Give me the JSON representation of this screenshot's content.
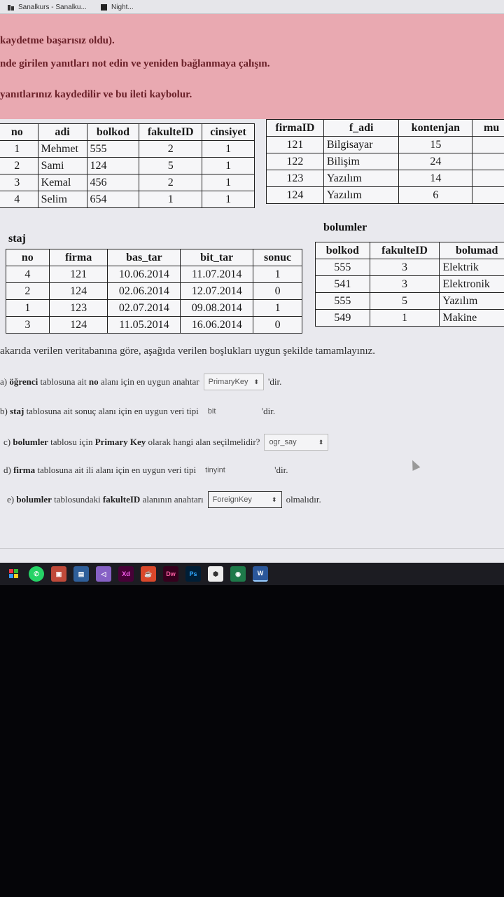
{
  "browser": {
    "tabs": [
      "Sanalkurs - Sanalku...",
      "Night..."
    ]
  },
  "alert": {
    "lines": [
      "kaydetme başarısız oldu).",
      "nde girilen yanıtları not edin ve yeniden bağlanmaya çalışın.",
      "yanıtlarınız kaydedilir ve bu ileti kaybolur."
    ]
  },
  "ogrenci": {
    "headers": [
      "no",
      "adi",
      "bolkod",
      "fakulteID",
      "cinsiyet"
    ],
    "rows": [
      [
        "1",
        "Mehmet",
        "555",
        "2",
        "1"
      ],
      [
        "2",
        "Sami",
        "124",
        "5",
        "1"
      ],
      [
        "3",
        "Kemal",
        "456",
        "2",
        "1"
      ],
      [
        "4",
        "Selim",
        "654",
        "1",
        "1"
      ]
    ]
  },
  "firma": {
    "headers": [
      "firmaID",
      "f_adi",
      "kontenjan",
      "mu"
    ],
    "rows": [
      [
        "121",
        "Bilgisayar",
        "15",
        ""
      ],
      [
        "122",
        "Bilişim",
        "24",
        ""
      ],
      [
        "123",
        "Yazılım",
        "14",
        ""
      ],
      [
        "124",
        "Yazılım",
        "6",
        ""
      ]
    ]
  },
  "staj": {
    "title": "staj",
    "headers": [
      "no",
      "firma",
      "bas_tar",
      "bit_tar",
      "sonuc"
    ],
    "rows": [
      [
        "4",
        "121",
        "10.06.2014",
        "11.07.2014",
        "1"
      ],
      [
        "2",
        "124",
        "02.06.2014",
        "12.07.2014",
        "0"
      ],
      [
        "1",
        "123",
        "02.07.2014",
        "09.08.2014",
        "1"
      ],
      [
        "3",
        "124",
        "11.05.2014",
        "16.06.2014",
        "0"
      ]
    ]
  },
  "bolumler": {
    "title": "bolumler",
    "headers": [
      "bolkod",
      "fakulteID",
      "bolumad"
    ],
    "rows": [
      [
        "555",
        "3",
        "Elektrik"
      ],
      [
        "541",
        "3",
        "Elektronik"
      ],
      [
        "555",
        "5",
        "Yazılım"
      ],
      [
        "549",
        "1",
        "Makine"
      ]
    ]
  },
  "instructions": "akarıda verilen veritabanına göre, aşağıda verilen boşlukları uygun şekilde tamamlayınız.",
  "questions": [
    {
      "prefix": "a)",
      "table": "öğrenci",
      "mid": "tablosuna ait",
      "field": "no",
      "rest": "alanı için en uygun anahtar",
      "value": "PrimaryKey",
      "suffix": "'dir."
    },
    {
      "prefix": "b)",
      "table": "staj",
      "mid": "tablosuna ait sonuç alanı için en uygun veri tipi",
      "field": "",
      "rest": "",
      "value": "bit",
      "suffix": "'dir."
    },
    {
      "prefix": "c)",
      "table": "bolumler",
      "mid": "tablosu için",
      "field": "Primary Key",
      "rest": "olarak hangi alan seçilmelidir?",
      "value": "ogr_say",
      "suffix": ""
    },
    {
      "prefix": "d)",
      "table": "firma",
      "mid": "tablosuna ait ili alanı için en uygun veri tipi",
      "field": "",
      "rest": "",
      "value": "tinyint",
      "suffix": "'dir."
    },
    {
      "prefix": "e)",
      "table": "bolumler",
      "mid": "tablosundaki",
      "field": "fakulteID",
      "rest": "alanının anahtarı",
      "value": "ForeignKey",
      "suffix": "olmalıdır."
    }
  ],
  "taskbar": {
    "icons": [
      "start-icon",
      "whatsapp-icon",
      "app-icon",
      "store-icon",
      "visual-studio-icon",
      "xd-icon",
      "java-icon",
      "dreamweaver-icon",
      "photoshop-icon",
      "package-icon",
      "chrome-icon",
      "word-icon"
    ],
    "labels": {
      "xd": "Xd",
      "dw": "Dw",
      "ps": "Ps",
      "word": "W"
    },
    "colors": {
      "xd": "#ff2bc2",
      "dw": "#e85d8a",
      "ps": "#31a8ff",
      "word": "#2b579a",
      "vs": "#8661c5",
      "whatsapp": "#25d366"
    }
  }
}
